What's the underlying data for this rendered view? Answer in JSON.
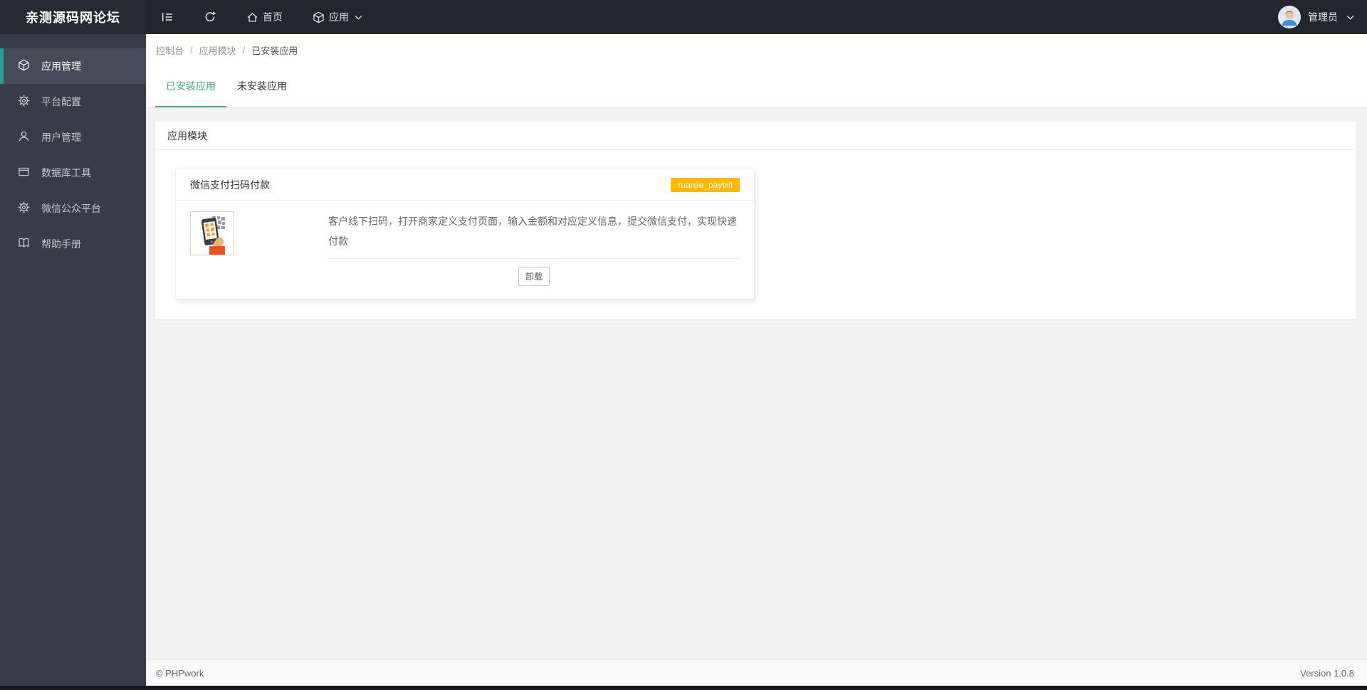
{
  "topbar": {
    "logo": "亲测源码网论坛",
    "home_label": "首页",
    "apps_label": "应用",
    "user_name": "管理员"
  },
  "sidebar": {
    "items": [
      {
        "label": "应用管理",
        "icon": "cube-icon",
        "active": true
      },
      {
        "label": "平台配置",
        "icon": "gear-icon",
        "active": false
      },
      {
        "label": "用户管理",
        "icon": "user-icon",
        "active": false
      },
      {
        "label": "数据库工具",
        "icon": "database-icon",
        "active": false
      },
      {
        "label": "微信公众平台",
        "icon": "gear-icon",
        "active": false
      },
      {
        "label": "帮助手册",
        "icon": "book-icon",
        "active": false
      }
    ]
  },
  "breadcrumb": {
    "separator": "/",
    "items": [
      "控制台",
      "应用模块",
      "已安装应用"
    ]
  },
  "tabs": {
    "installed": "已安装应用",
    "uninstalled": "未安装应用"
  },
  "panel": {
    "title": "应用模块"
  },
  "app": {
    "title": "微信支付扫码付款",
    "badge": "ruanjie_paybill",
    "description": "客户线下扫码，打开商家定义支付页面，输入金额和对应定义信息，提交微信支付，实现快速付款",
    "uninstall_label": "卸载"
  },
  "footer": {
    "copyright": "© PHPwork",
    "version": "Version 1.0.8"
  },
  "colors": {
    "topbar_bg": "#23262e",
    "sidebar_bg": "#373c46",
    "sidebar_active_bg": "#454c58",
    "sidebar_accent": "#26a295",
    "tab_active": "#47a983",
    "badge": "#ffb800",
    "body_bg": "#f2f2f2"
  }
}
